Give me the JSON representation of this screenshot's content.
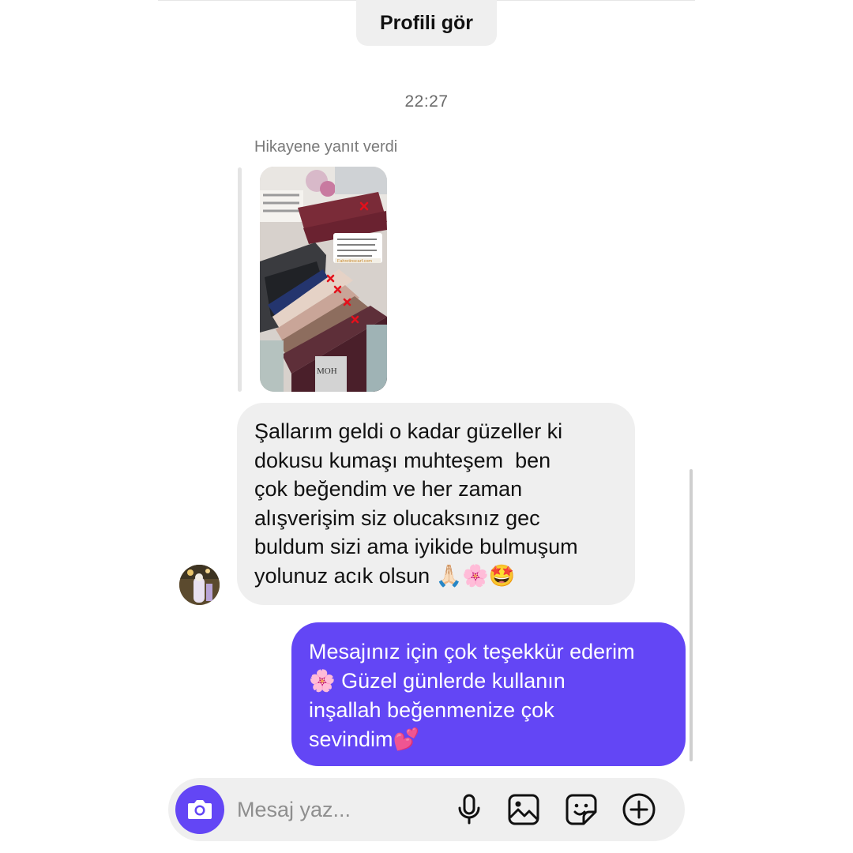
{
  "header": {
    "view_profile_label": "Profili gör"
  },
  "thread": {
    "timestamp": "22:27",
    "story_reply_label": "Hikayene yanıt verdi",
    "story_thumbnail": {
      "caption_link": "Fahretinscarf.com",
      "mark_color": "#e4101b"
    },
    "incoming_message": "Şallarım geldi o kadar güzeller ki\ndokusu kumaşı muhteşem  ben\nçok beğendim ve her zaman\nalışverişim siz olucaksınız gec\nbuldum sizi ama iyikide bulmuşum\nyolunuz acık olsun 🙏🏻🌸🤩",
    "outgoing_message": "Mesajınız için çok teşekkür ederim\n🌸 Güzel günlerde kullanın\ninşallah beğenmenize çok\nsevindim💕"
  },
  "composer": {
    "placeholder": "Mesaj yaz...",
    "icons": [
      "camera-icon",
      "microphone-icon",
      "gallery-icon",
      "sticker-icon",
      "add-icon"
    ]
  },
  "colors": {
    "accent": "#6346f5",
    "incoming_bubble": "#efefef",
    "secondary_text": "#7a7a7a"
  }
}
